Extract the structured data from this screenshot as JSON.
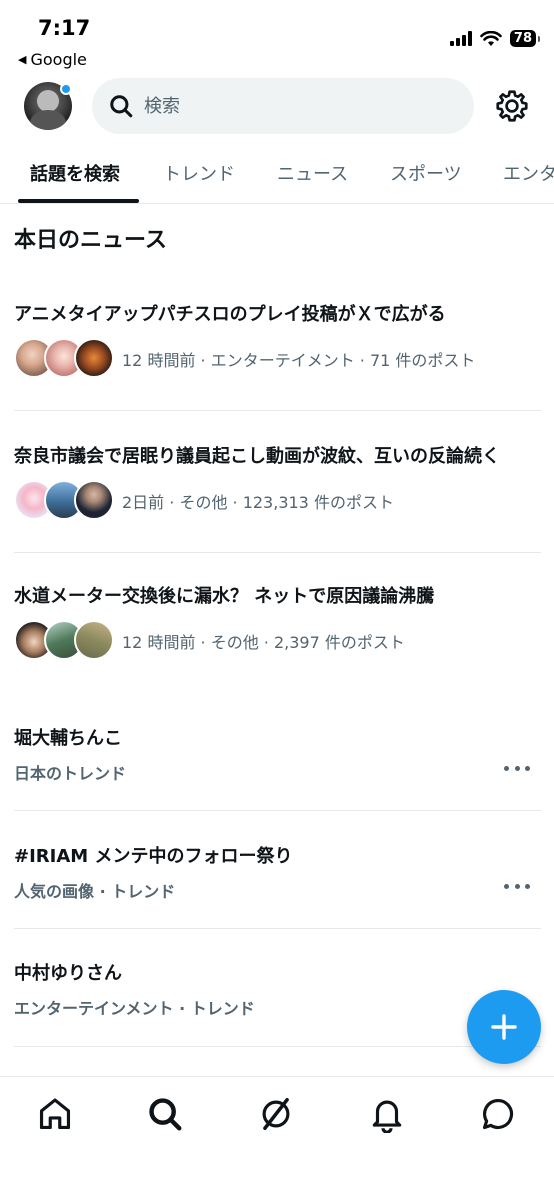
{
  "status_bar": {
    "time": "7:17",
    "back_app": "Google",
    "battery": "78"
  },
  "search": {
    "placeholder": "検索"
  },
  "tabs": [
    {
      "label": "話題を検索",
      "active": true
    },
    {
      "label": "トレンド",
      "active": false
    },
    {
      "label": "ニュース",
      "active": false
    },
    {
      "label": "スポーツ",
      "active": false
    },
    {
      "label": "エンタ",
      "active": false
    }
  ],
  "section_title": "本日のニュース",
  "news": [
    {
      "headline": "アニメタイアップパチスロのプレイ投稿がＸで広がる",
      "meta": "12 時間前 · エンターテイメント · 71 件のポスト"
    },
    {
      "headline": "奈良市議会で居眠り議員起こし動画が波紋、互いの反論続く",
      "meta": "2日前 · その他 · 123,313 件のポスト"
    },
    {
      "headline": "水道メーター交換後に漏水？ ネットで原因議論沸騰",
      "meta": "12 時間前 · その他 · 2,397 件のポスト"
    }
  ],
  "trends": [
    {
      "name": "堀大輔ちんこ",
      "meta": "日本のトレンド"
    },
    {
      "name": "#IRIAM メンテ中のフォロー祭り",
      "meta": "人気の画像 · トレンド"
    },
    {
      "name": "中村ゆりさん",
      "meta": "エンターテインメント · トレンド"
    }
  ],
  "icons": {
    "search": "search-icon",
    "settings": "gear-icon",
    "compose": "plus-icon",
    "nav": [
      "home-icon",
      "search-icon",
      "grok-icon",
      "bell-icon",
      "message-icon"
    ]
  },
  "colors": {
    "accent": "#1d9bf0",
    "text": "#0f1419",
    "secondary": "#536471",
    "divider": "#e6e9eb"
  }
}
